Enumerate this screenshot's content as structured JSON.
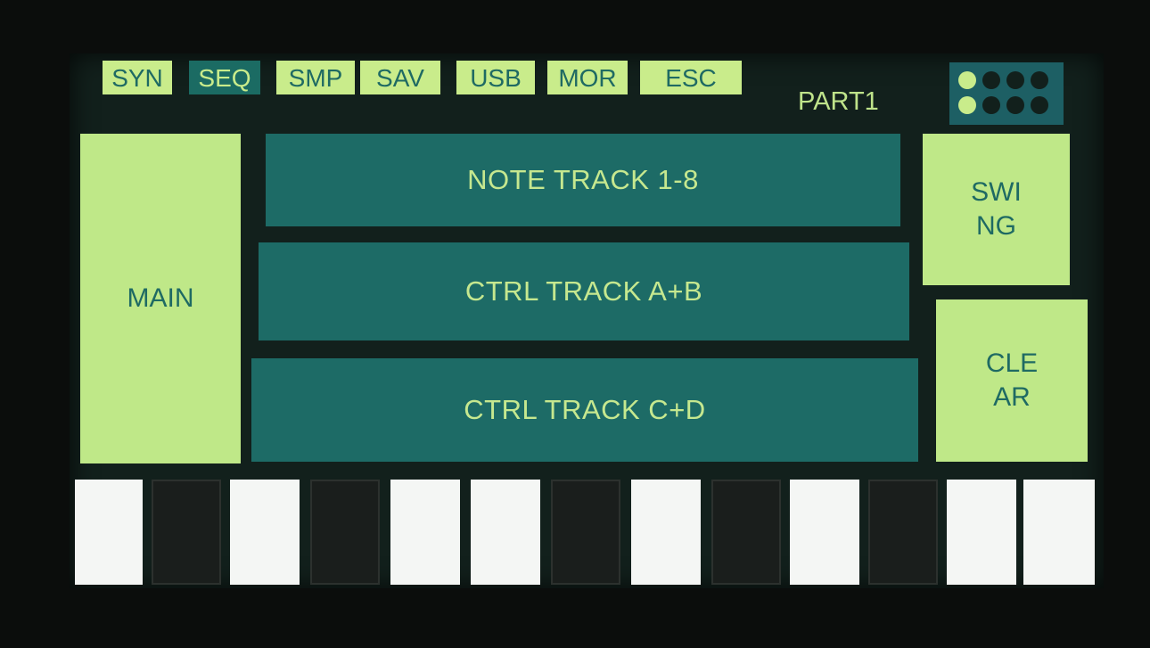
{
  "tabs": [
    {
      "label": "SYN",
      "active": false
    },
    {
      "label": "SEQ",
      "active": true
    },
    {
      "label": "SMP",
      "active": false
    },
    {
      "label": "SAV",
      "active": false
    },
    {
      "label": "USB",
      "active": false
    },
    {
      "label": "MOR",
      "active": false
    },
    {
      "label": "ESC",
      "active": false
    }
  ],
  "part_label": "PART1",
  "voice_indicator": {
    "rows": [
      [
        true,
        false,
        false,
        false
      ],
      [
        true,
        false,
        false,
        false
      ]
    ]
  },
  "main_button": "MAIN",
  "tracks": [
    "NOTE TRACK 1-8",
    "CTRL TRACK A+B",
    "CTRL TRACK C+D"
  ],
  "swing_button": [
    "SWI",
    "NG"
  ],
  "clear_button": [
    "CLE",
    "AR"
  ],
  "keys": [
    "white",
    "black",
    "white",
    "black",
    "white",
    "white",
    "black",
    "white",
    "black",
    "white",
    "black",
    "white",
    "white"
  ],
  "colors": {
    "accent": "#c9ec8b",
    "teal": "#1d6b66",
    "background": "#12201c"
  }
}
